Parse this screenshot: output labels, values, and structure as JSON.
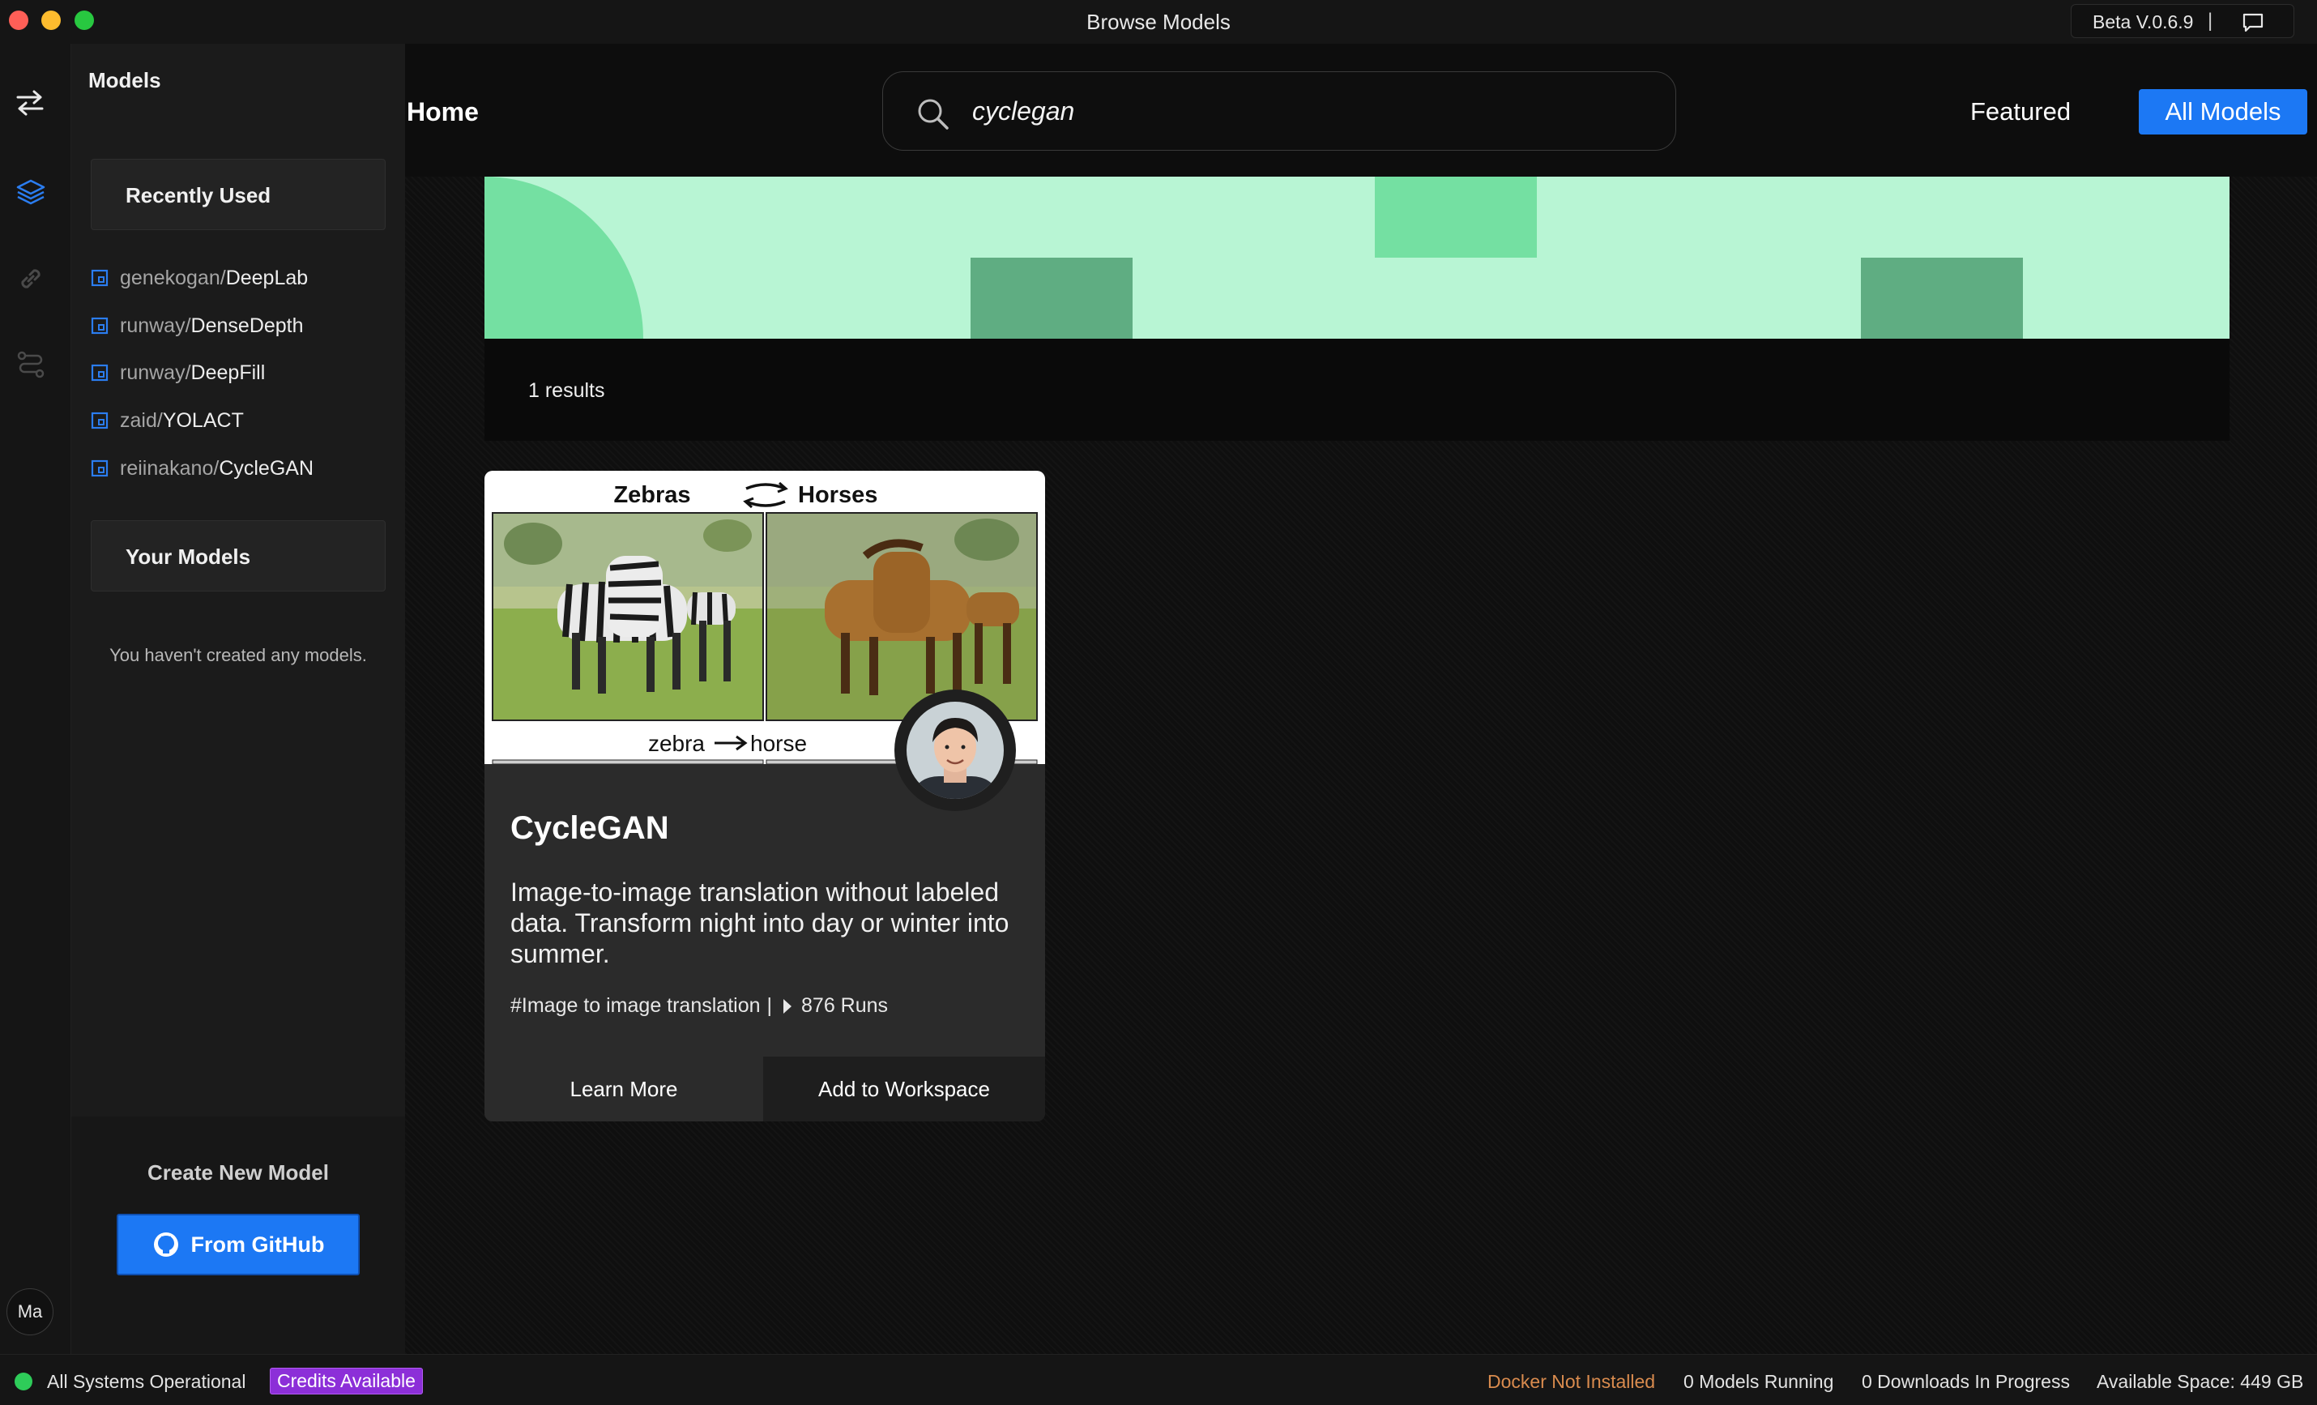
{
  "window": {
    "title": "Browse Models",
    "version": "Beta V.0.6.9",
    "version_sep": "|"
  },
  "rail": {
    "avatar_initials": "Ma"
  },
  "sidebar": {
    "title": "Models",
    "recently_used_label": "Recently Used",
    "recent_models": [
      {
        "owner": "genekogan/",
        "name": "DeepLab"
      },
      {
        "owner": "runway/",
        "name": "DenseDepth"
      },
      {
        "owner": "runway/",
        "name": "DeepFill"
      },
      {
        "owner": "zaid/",
        "name": "YOLACT"
      },
      {
        "owner": "reiinakano/",
        "name": "CycleGAN"
      }
    ],
    "your_models_label": "Your Models",
    "empty_note": "You haven't created any models.",
    "create_title": "Create New Model",
    "github_button": "From GitHub"
  },
  "header": {
    "home": "Home",
    "search_value": "cyclegan",
    "nav_featured": "Featured",
    "nav_all": "All Models"
  },
  "results": {
    "count_text": "1 results"
  },
  "card": {
    "image_title_left": "Zebras",
    "image_title_right": "Horses",
    "image_caption_left": "zebra",
    "image_caption_right": "horse",
    "title": "CycleGAN",
    "description": "Image-to-image translation without labeled data. Transform night into day or winter into summer.",
    "tag": "#Image to image translation",
    "tag_sep": "|",
    "runs": "876 Runs",
    "learn_more": "Learn More",
    "add_to_workspace": "Add to Workspace"
  },
  "status": {
    "systems": "All Systems Operational",
    "credits": "Credits Available",
    "docker": "Docker Not Installed",
    "models_running": "0 Models Running",
    "downloads": "0 Downloads In Progress",
    "space": "Available Space: 449 GB"
  },
  "colors": {
    "accent": "#1c78f4",
    "banner": "#b8f5d4",
    "status_ok": "#2ecc59",
    "credits": "#8c2fd8",
    "docker_warning": "#d98b4e"
  }
}
